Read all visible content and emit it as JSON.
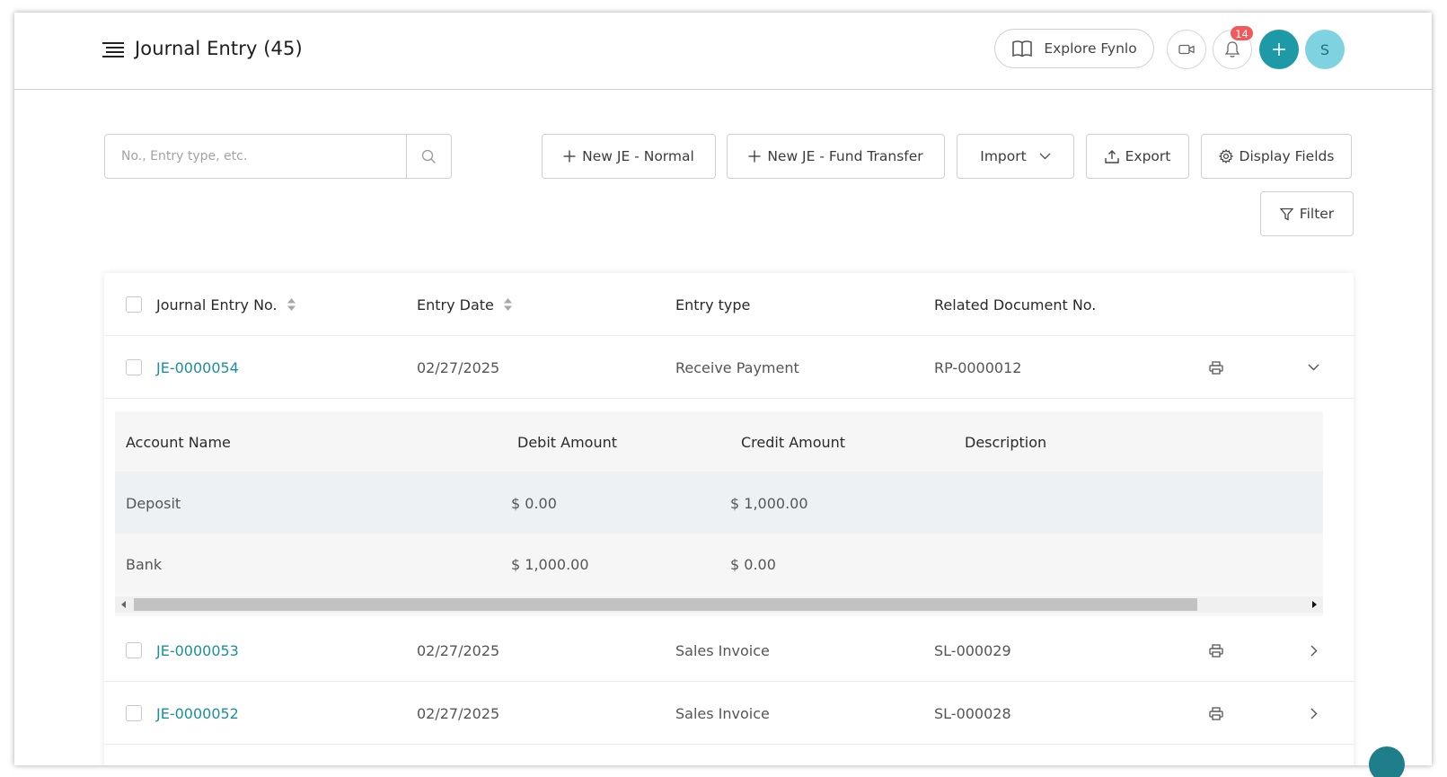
{
  "header": {
    "title": "Journal Entry (45)",
    "explore_label": "Explore Fynlo",
    "notification_count": "14",
    "add_label": "+",
    "avatar_initial": "S"
  },
  "toolbar": {
    "search_placeholder": "No., Entry type, etc.",
    "new_normal_label": "New JE - Normal",
    "new_fund_label": "New JE - Fund Transfer",
    "import_label": "Import",
    "export_label": "Export",
    "display_fields_label": "Display Fields",
    "filter_label": "Filter"
  },
  "table": {
    "columns": {
      "entry_no": "Journal Entry No.",
      "entry_date": "Entry Date",
      "entry_type": "Entry type",
      "related_doc": "Related Document No."
    },
    "rows": [
      {
        "no": "JE-0000054",
        "date": "02/27/2025",
        "type": "Receive Payment",
        "related": "RP-0000012",
        "expanded": true
      },
      {
        "no": "JE-0000053",
        "date": "02/27/2025",
        "type": "Sales Invoice",
        "related": "SL-000029",
        "expanded": false
      },
      {
        "no": "JE-0000052",
        "date": "02/27/2025",
        "type": "Sales Invoice",
        "related": "SL-000028",
        "expanded": false
      }
    ]
  },
  "detail": {
    "columns": {
      "account": "Account Name",
      "debit": "Debit Amount",
      "credit": "Credit Amount",
      "description": "Description"
    },
    "rows": [
      {
        "account": "Deposit",
        "debit": "$ 0.00",
        "credit": "$ 1,000.00",
        "description": ""
      },
      {
        "account": "Bank",
        "debit": "$ 1,000.00",
        "credit": "$ 0.00",
        "description": ""
      }
    ]
  },
  "colors": {
    "accent": "#1e9aa6",
    "link": "#1b8f9b",
    "badge": "#f05a5a",
    "avatar_bg": "#7fd3e0"
  }
}
